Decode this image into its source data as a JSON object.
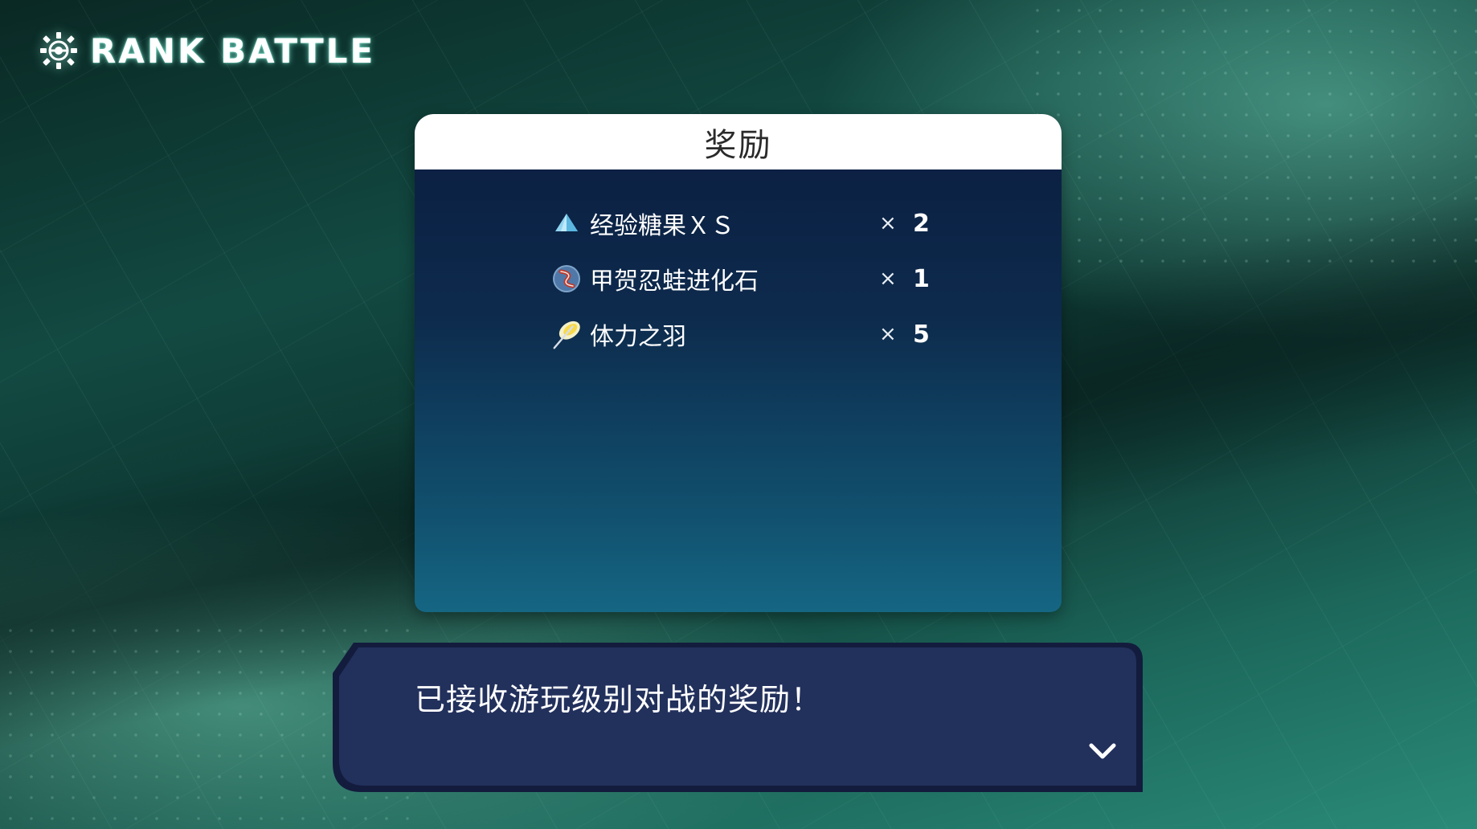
{
  "header": {
    "title": "RANK BATTLE",
    "icon": "gear-pokeball-emblem-icon"
  },
  "rewards_panel": {
    "title": "奖励",
    "items": [
      {
        "name": "经验糖果ＸＳ",
        "multiplier": "×",
        "quantity": "2",
        "icon": "candy-crystal-icon"
      },
      {
        "name": "甲贺忍蛙进化石",
        "multiplier": "×",
        "quantity": "1",
        "icon": "mega-stone-icon"
      },
      {
        "name": "体力之羽",
        "multiplier": "×",
        "quantity": "5",
        "icon": "feather-icon"
      }
    ]
  },
  "dialog": {
    "message": "已接收游玩级别对战的奖励！",
    "advance_icon": "chevron-down-icon"
  },
  "colors": {
    "panel_header_bg": "#ffffff",
    "panel_body_top": "#0b1d40",
    "panel_body_bottom": "#156683",
    "dialog_bg": "#22305c",
    "dialog_border": "#131c3d",
    "background_teal": "#2a8a78"
  }
}
